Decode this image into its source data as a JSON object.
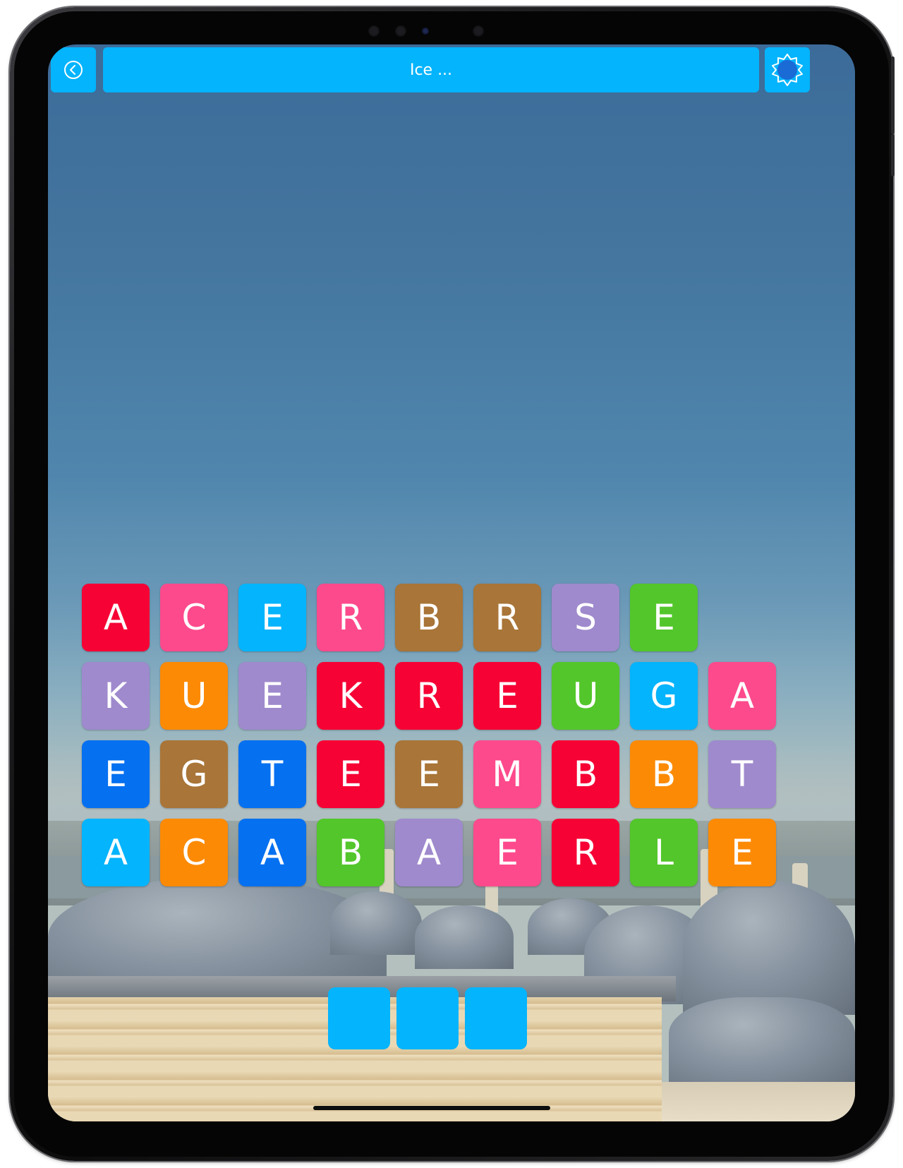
{
  "header": {
    "title": "Ice ..."
  },
  "icons": {
    "back": "back-circle-arrow-icon",
    "settings": "gear-icon"
  },
  "colors": {
    "accent": "#04b4fc",
    "red": "#f60235",
    "pink": "#fd4a8c",
    "sky": "#04b4fc",
    "brown": "#a97538",
    "purple": "#9f8acd",
    "green": "#53c62b",
    "orange": "#fc8a05",
    "blue": "#0570f0"
  },
  "board": {
    "rows": [
      [
        {
          "letter": "A",
          "color": "red"
        },
        {
          "letter": "C",
          "color": "pink"
        },
        {
          "letter": "E",
          "color": "sky"
        },
        {
          "letter": "R",
          "color": "pink"
        },
        {
          "letter": "B",
          "color": "brown"
        },
        {
          "letter": "R",
          "color": "brown"
        },
        {
          "letter": "S",
          "color": "purple"
        },
        {
          "letter": "E",
          "color": "green"
        }
      ],
      [
        {
          "letter": "K",
          "color": "purple"
        },
        {
          "letter": "U",
          "color": "orange"
        },
        {
          "letter": "E",
          "color": "purple"
        },
        {
          "letter": "K",
          "color": "red"
        },
        {
          "letter": "R",
          "color": "red"
        },
        {
          "letter": "E",
          "color": "red"
        },
        {
          "letter": "U",
          "color": "green"
        },
        {
          "letter": "G",
          "color": "sky"
        },
        {
          "letter": "A",
          "color": "pink"
        }
      ],
      [
        {
          "letter": "E",
          "color": "blue"
        },
        {
          "letter": "G",
          "color": "brown"
        },
        {
          "letter": "T",
          "color": "blue"
        },
        {
          "letter": "E",
          "color": "red"
        },
        {
          "letter": "E",
          "color": "brown"
        },
        {
          "letter": "M",
          "color": "pink"
        },
        {
          "letter": "B",
          "color": "red"
        },
        {
          "letter": "B",
          "color": "orange"
        },
        {
          "letter": "T",
          "color": "purple"
        }
      ],
      [
        {
          "letter": "A",
          "color": "sky"
        },
        {
          "letter": "C",
          "color": "orange"
        },
        {
          "letter": "A",
          "color": "blue"
        },
        {
          "letter": "B",
          "color": "green"
        },
        {
          "letter": "A",
          "color": "purple"
        },
        {
          "letter": "E",
          "color": "pink"
        },
        {
          "letter": "R",
          "color": "red"
        },
        {
          "letter": "L",
          "color": "green"
        },
        {
          "letter": "E",
          "color": "orange"
        }
      ]
    ]
  },
  "answer": {
    "slots": [
      "",
      "",
      ""
    ]
  }
}
